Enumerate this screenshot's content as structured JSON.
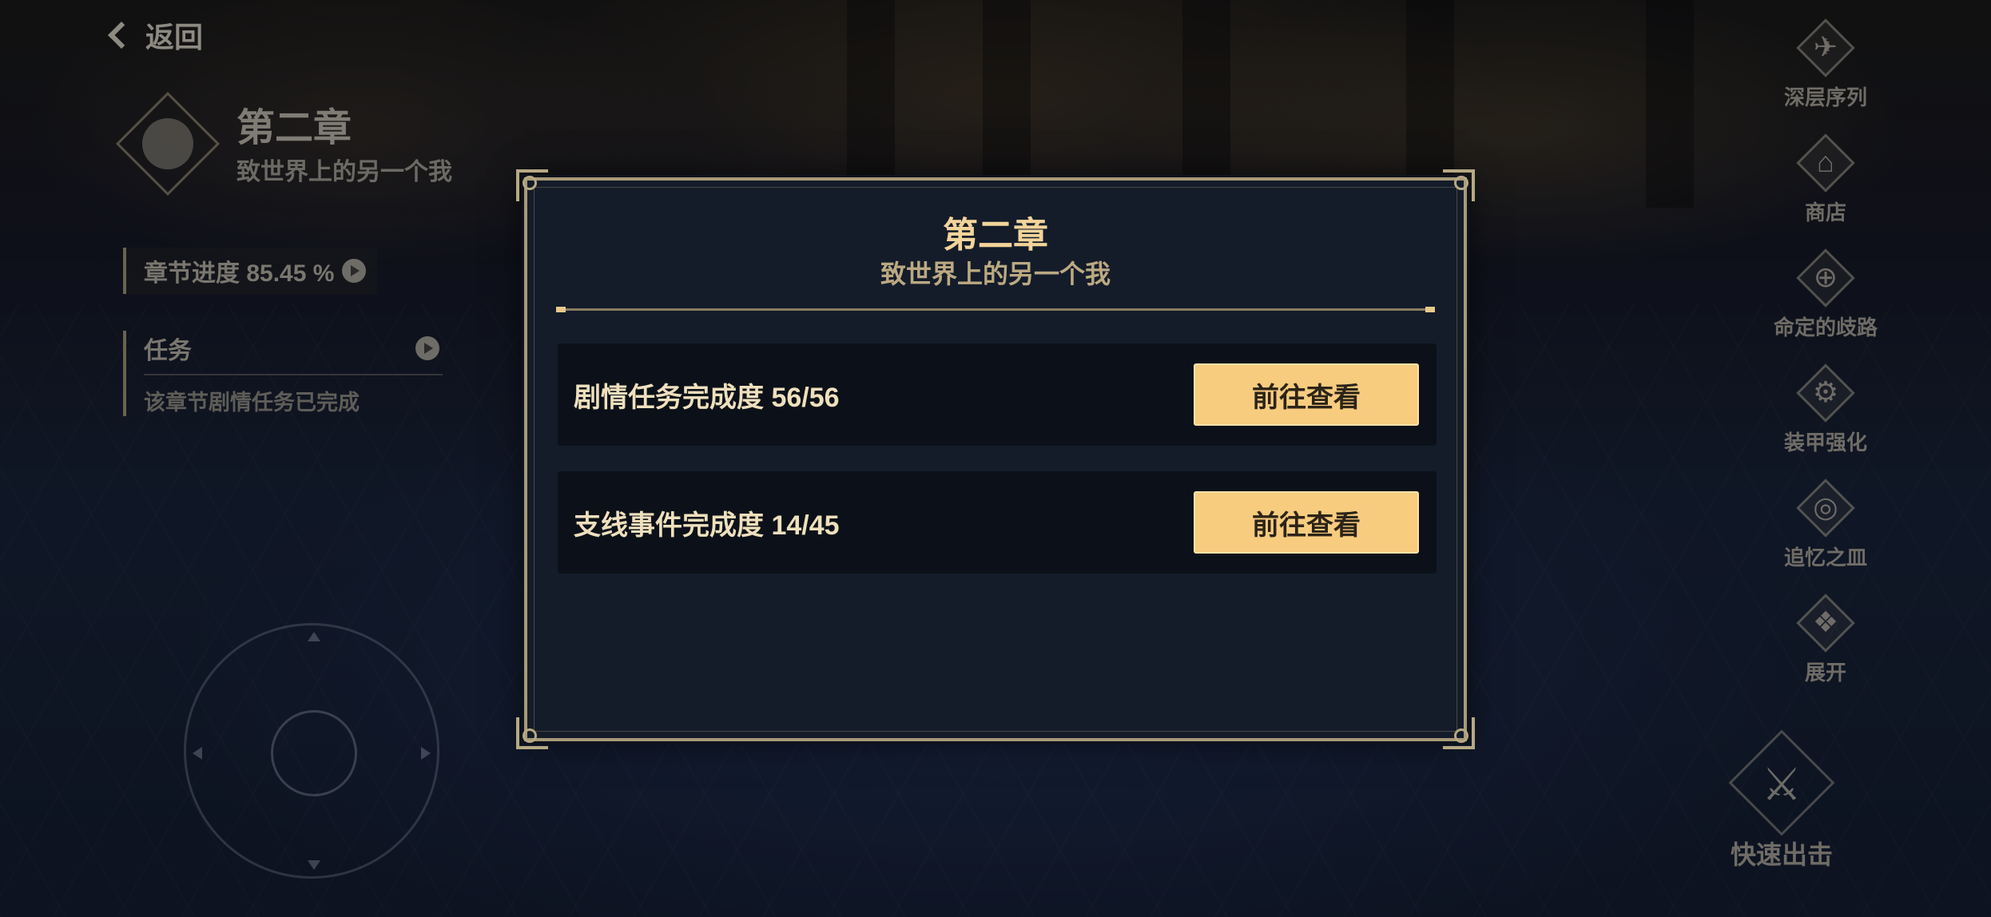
{
  "back": {
    "label": "返回"
  },
  "chapter": {
    "title": "第二章",
    "subtitle": "致世界上的另一个我",
    "progress_label": "章节进度 85.45 %",
    "task_title": "任务",
    "task_desc": "该章节剧情任务已完成"
  },
  "right_menu": [
    {
      "label": "深层序列",
      "icon": "deep-sequence-icon",
      "glyph": "✈"
    },
    {
      "label": "商店",
      "icon": "shop-icon",
      "glyph": "⌂"
    },
    {
      "label": "命定的歧路",
      "icon": "fated-path-icon",
      "glyph": "⊕"
    },
    {
      "label": "装甲强化",
      "icon": "armor-upgrade-icon",
      "glyph": "⚙"
    },
    {
      "label": "追忆之皿",
      "icon": "memory-vessel-icon",
      "glyph": "◎"
    },
    {
      "label": "展开",
      "icon": "expand-icon",
      "glyph": "❖"
    }
  ],
  "quick_strike": {
    "label": "快速出击",
    "icon": "quick-strike-icon",
    "glyph": "⚔"
  },
  "modal": {
    "title": "第二章",
    "subtitle": "致世界上的另一个我",
    "rows": [
      {
        "label": "剧情任务完成度 56/56",
        "button": "前往查看"
      },
      {
        "label": "支线事件完成度 14/45",
        "button": "前往查看"
      }
    ]
  },
  "colors": {
    "accent_gold": "#f8cc7f",
    "title_gold": "#f2d49a",
    "modal_border": "#a89a77",
    "modal_bg": "#141c2a"
  }
}
